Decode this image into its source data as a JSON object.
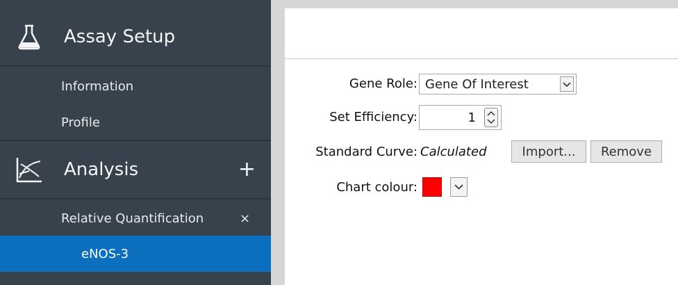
{
  "sidebar": {
    "assay_setup": {
      "title": "Assay Setup",
      "icon": "flask-icon",
      "items": [
        {
          "label": "Information"
        },
        {
          "label": "Profile"
        }
      ]
    },
    "analysis": {
      "title": "Analysis",
      "icon": "chart-icon",
      "add_label": "+",
      "items": [
        {
          "label": "Relative Quantification",
          "close": "×"
        },
        {
          "label": "eNOS-3",
          "selected": true
        }
      ]
    }
  },
  "form": {
    "gene_role": {
      "label": "Gene Role:",
      "value": "Gene Of Interest"
    },
    "set_efficiency": {
      "label": "Set Efficiency:",
      "value": "1"
    },
    "standard_curve": {
      "label": "Standard Curve:",
      "value": "Calculated",
      "import_label": "Import...",
      "remove_label": "Remove"
    },
    "chart_colour": {
      "label": "Chart colour:",
      "color": "#ff0000"
    }
  },
  "colors": {
    "sidebar_bg": "#37424d",
    "accent": "#0a6fbf",
    "swatch": "#ff0000"
  }
}
